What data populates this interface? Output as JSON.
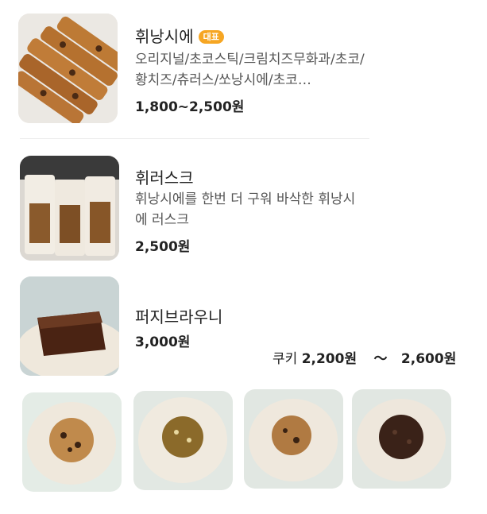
{
  "menu": [
    {
      "name": "휘낭시에",
      "badge": "대표",
      "description": "오리지널/초코스틱/크림치즈무화과/초코/황치즈/츄러스/쏘낭시에/초코…",
      "price": "1,800~2,500원"
    },
    {
      "name": "휘러스크",
      "description": "휘낭시에를 한번 더 구워 바삭한 휘낭시에 러스크",
      "price": "2,500원"
    },
    {
      "name": "퍼지브라우니",
      "price": "3,000원"
    }
  ],
  "cookie_line": {
    "name": "쿠키",
    "price_from": "2,200원",
    "tilde": "〜",
    "price_to": "2,600원"
  },
  "colors": {
    "badge": "#f6a623",
    "divider": "#ececec"
  }
}
